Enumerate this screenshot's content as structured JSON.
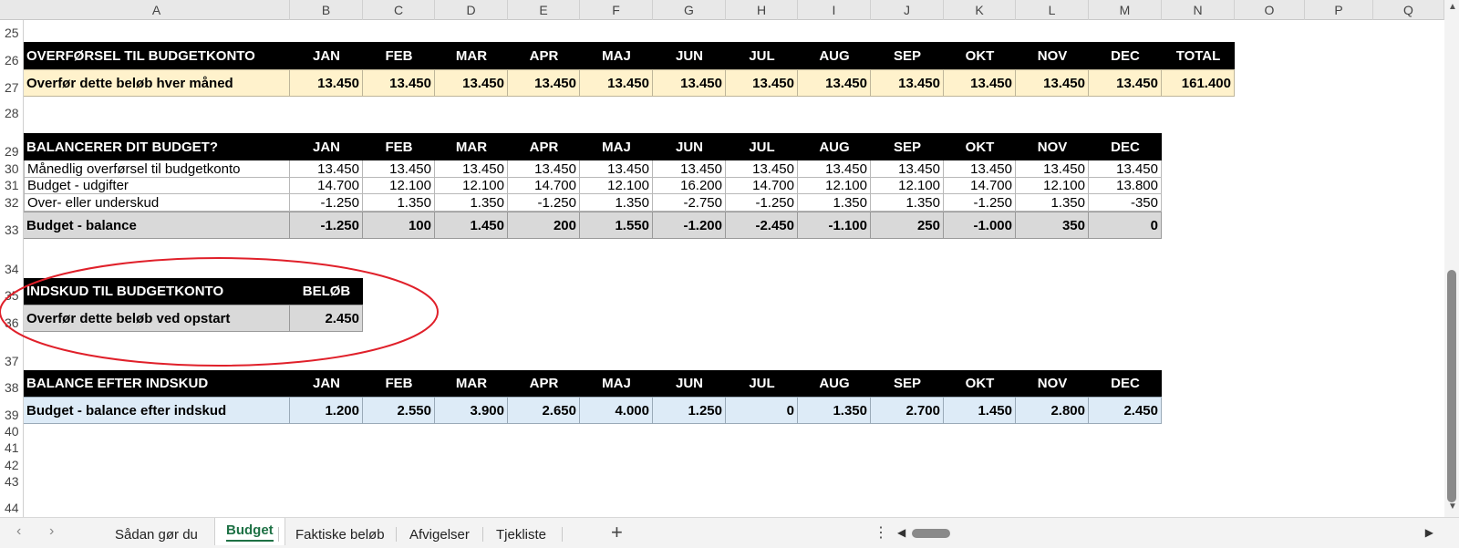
{
  "columns": [
    "A",
    "B",
    "C",
    "D",
    "E",
    "F",
    "G",
    "H",
    "I",
    "J",
    "K",
    "L",
    "M",
    "N",
    "O",
    "P",
    "Q"
  ],
  "row_numbers": [
    "25",
    "26",
    "27",
    "28",
    "29",
    "30",
    "31",
    "32",
    "33",
    "34",
    "35",
    "36",
    "37",
    "38",
    "39",
    "40",
    "41",
    "42",
    "43",
    "44"
  ],
  "section_transfer": {
    "header": [
      "OVERFØRSEL TIL BUDGETKONTO",
      "JAN",
      "FEB",
      "MAR",
      "APR",
      "MAJ",
      "JUN",
      "JUL",
      "AUG",
      "SEP",
      "OKT",
      "NOV",
      "DEC",
      "TOTAL"
    ],
    "row": [
      "Overfør dette beløb hver måned",
      "13.450",
      "13.450",
      "13.450",
      "13.450",
      "13.450",
      "13.450",
      "13.450",
      "13.450",
      "13.450",
      "13.450",
      "13.450",
      "13.450",
      "161.400"
    ]
  },
  "section_balance": {
    "header": [
      "BALANCERER DIT BUDGET?",
      "JAN",
      "FEB",
      "MAR",
      "APR",
      "MAJ",
      "JUN",
      "JUL",
      "AUG",
      "SEP",
      "OKT",
      "NOV",
      "DEC"
    ],
    "rows": [
      [
        "Månedlig overførsel til budgetkonto",
        "13.450",
        "13.450",
        "13.450",
        "13.450",
        "13.450",
        "13.450",
        "13.450",
        "13.450",
        "13.450",
        "13.450",
        "13.450",
        "13.450"
      ],
      [
        "Budget - udgifter",
        "14.700",
        "12.100",
        "12.100",
        "14.700",
        "12.100",
        "16.200",
        "14.700",
        "12.100",
        "12.100",
        "14.700",
        "12.100",
        "13.800"
      ],
      [
        "Over- eller underskud",
        "-1.250",
        "1.350",
        "1.350",
        "-1.250",
        "1.350",
        "-2.750",
        "-1.250",
        "1.350",
        "1.350",
        "-1.250",
        "1.350",
        "-350"
      ]
    ],
    "total": [
      "Budget - balance",
      "-1.250",
      "100",
      "1.450",
      "200",
      "1.550",
      "-1.200",
      "-2.450",
      "-1.100",
      "250",
      "-1.000",
      "350",
      "0"
    ]
  },
  "section_deposit": {
    "header": [
      "INDSKUD TIL BUDGETKONTO",
      "BELØB"
    ],
    "row": [
      "Overfør dette beløb ved opstart",
      "2.450"
    ]
  },
  "section_after": {
    "header": [
      "BALANCE EFTER INDSKUD",
      "JAN",
      "FEB",
      "MAR",
      "APR",
      "MAJ",
      "JUN",
      "JUL",
      "AUG",
      "SEP",
      "OKT",
      "NOV",
      "DEC"
    ],
    "row": [
      "Budget - balance efter indskud",
      "1.200",
      "2.550",
      "3.900",
      "2.650",
      "4.000",
      "1.250",
      "0",
      "1.350",
      "2.700",
      "1.450",
      "2.800",
      "2.450"
    ]
  },
  "tabs": [
    {
      "label": "Sådan gør du",
      "active": false
    },
    {
      "label": "Budget",
      "active": true
    },
    {
      "label": "Faktiske beløb",
      "active": false
    },
    {
      "label": "Afvigelser",
      "active": false
    },
    {
      "label": "Tjekliste",
      "active": false
    }
  ],
  "add_sheet_label": "+",
  "more_label": "⋮",
  "highlight_color": "#e0202a"
}
